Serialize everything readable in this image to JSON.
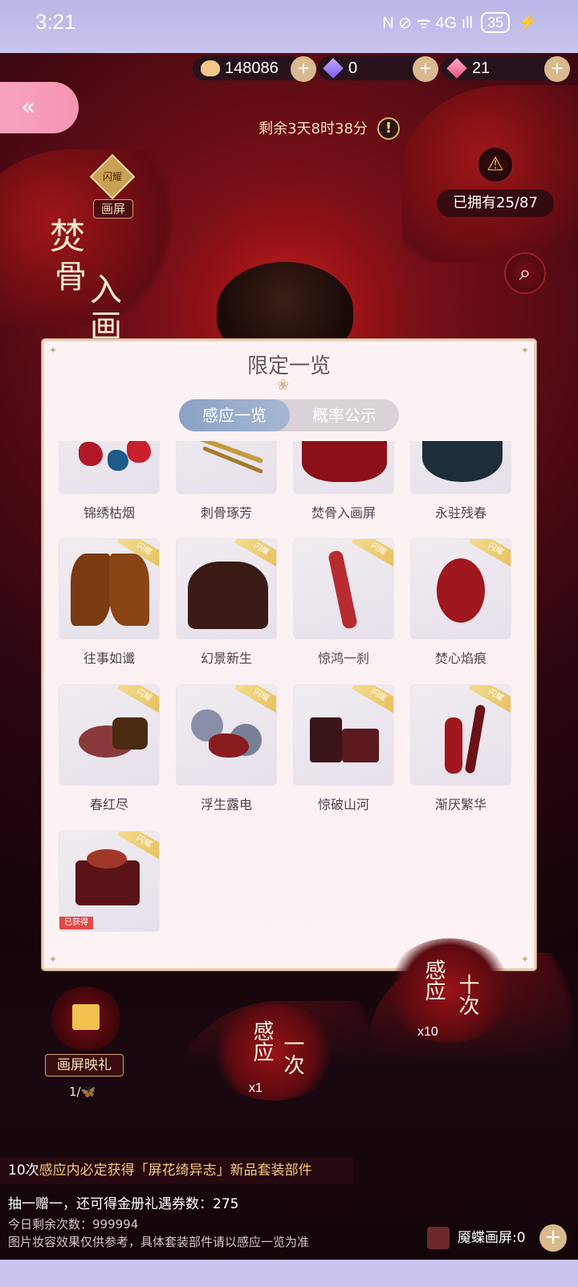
{
  "status_bar": {
    "time": "3:21",
    "indicators": "N ⊘ ᯤ 4G ıll",
    "battery": "35"
  },
  "currency": {
    "coins": "148086",
    "diamond": "0",
    "gems": "21",
    "plus": "+"
  },
  "header": {
    "back": "«",
    "timer": "剩余3天8时38分",
    "timer_info": "!",
    "owned": "已拥有25/87"
  },
  "event": {
    "title_chars": [
      "焚",
      "骨",
      "入",
      "画"
    ],
    "tag_flash": "闪耀",
    "tag_screen": "画屏"
  },
  "modal": {
    "title": "限定一览",
    "tabs": [
      "感应一览",
      "概率公示"
    ],
    "items": [
      {
        "name": "锦绣枯烟",
        "flash": false,
        "obtained": false
      },
      {
        "name": "刺骨琢芳",
        "flash": false,
        "obtained": false
      },
      {
        "name": "焚骨入画屏",
        "flash": false,
        "obtained": false
      },
      {
        "name": "永驻残春",
        "flash": false,
        "obtained": false
      },
      {
        "name": "往事如谶",
        "flash": true,
        "obtained": false
      },
      {
        "name": "幻景新生",
        "flash": true,
        "obtained": false
      },
      {
        "name": "惊鸿一刹",
        "flash": true,
        "obtained": false
      },
      {
        "name": "焚心焰痕",
        "flash": true,
        "obtained": false
      },
      {
        "name": "春红尽",
        "flash": true,
        "obtained": false
      },
      {
        "name": "浮生露电",
        "flash": true,
        "obtained": false
      },
      {
        "name": "惊破山河",
        "flash": true,
        "obtained": false
      },
      {
        "name": "渐厌繁华",
        "flash": true,
        "obtained": false
      },
      {
        "name": "",
        "flash": true,
        "obtained": true
      }
    ],
    "flash_label": "闪耀",
    "obtained_label": "已获得"
  },
  "bottom": {
    "gift_label": "画屏映礼",
    "gift_count": "1/",
    "draw_one": {
      "chars1": "感应",
      "chars2": "一次",
      "cost": "x1"
    },
    "draw_ten": {
      "chars1": "感应",
      "chars2": "十次",
      "cost": "x10"
    },
    "info_pre": "10次",
    "info_hl": "感应内必定获得「屏花绮异志」新品套装部件",
    "info2": "抽一赠一，还可得金册礼遇券数：275",
    "info3": "今日剩余次数：999994",
    "info4": "图片妆容效果仅供参考，具体套装部件请以感应一览为准",
    "resource": "魇蝶画屏:0"
  },
  "colors": {
    "accent_pink": "#f595b4",
    "gold": "#d9b98e",
    "tab_active": "#8aa2c6"
  }
}
